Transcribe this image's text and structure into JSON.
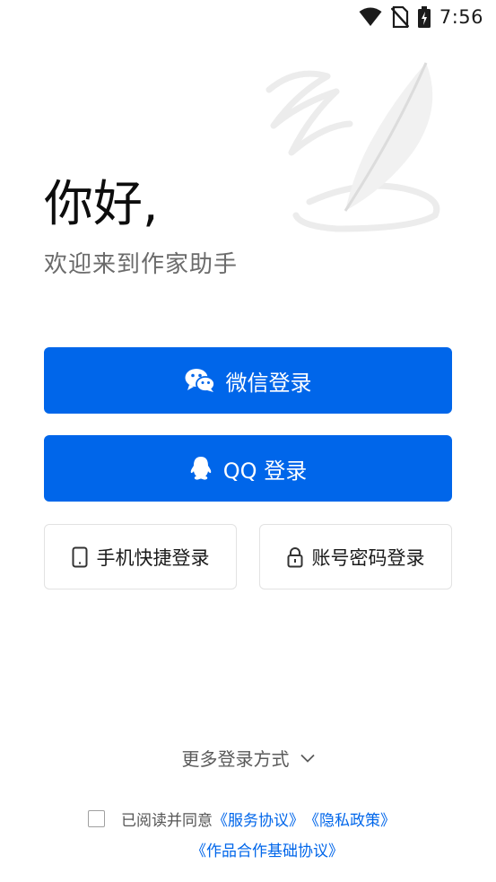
{
  "status_bar": {
    "time": "7:56",
    "icons": [
      "wifi-icon",
      "no-sim-icon",
      "battery-charging-icon"
    ]
  },
  "greeting": {
    "title": "你好,",
    "subtitle": "欢迎来到作家助手"
  },
  "buttons": {
    "wechat_login": "微信登录",
    "qq_login": "QQ 登录",
    "phone_login": "手机快捷登录",
    "account_login": "账号密码登录"
  },
  "more_login": "更多登录方式",
  "agreement": {
    "prefix": "已阅读并同意",
    "service_agreement": "《服务协议》",
    "privacy_policy": "《隐私政策》",
    "works_agreement": "《作品合作基础协议》"
  },
  "colors": {
    "primary": "#0066ea",
    "background": "#ffffff"
  }
}
